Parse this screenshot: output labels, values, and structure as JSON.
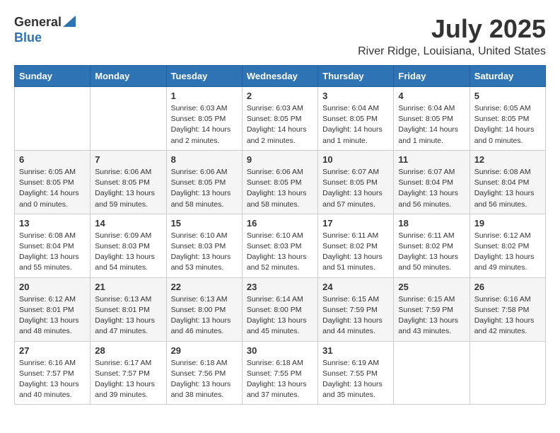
{
  "header": {
    "logo_general": "General",
    "logo_blue": "Blue",
    "title": "July 2025",
    "subtitle": "River Ridge, Louisiana, United States"
  },
  "calendar": {
    "days_of_week": [
      "Sunday",
      "Monday",
      "Tuesday",
      "Wednesday",
      "Thursday",
      "Friday",
      "Saturday"
    ],
    "weeks": [
      [
        {
          "num": "",
          "info": ""
        },
        {
          "num": "",
          "info": ""
        },
        {
          "num": "1",
          "info": "Sunrise: 6:03 AM\nSunset: 8:05 PM\nDaylight: 14 hours\nand 2 minutes."
        },
        {
          "num": "2",
          "info": "Sunrise: 6:03 AM\nSunset: 8:05 PM\nDaylight: 14 hours\nand 2 minutes."
        },
        {
          "num": "3",
          "info": "Sunrise: 6:04 AM\nSunset: 8:05 PM\nDaylight: 14 hours\nand 1 minute."
        },
        {
          "num": "4",
          "info": "Sunrise: 6:04 AM\nSunset: 8:05 PM\nDaylight: 14 hours\nand 1 minute."
        },
        {
          "num": "5",
          "info": "Sunrise: 6:05 AM\nSunset: 8:05 PM\nDaylight: 14 hours\nand 0 minutes."
        }
      ],
      [
        {
          "num": "6",
          "info": "Sunrise: 6:05 AM\nSunset: 8:05 PM\nDaylight: 14 hours\nand 0 minutes."
        },
        {
          "num": "7",
          "info": "Sunrise: 6:06 AM\nSunset: 8:05 PM\nDaylight: 13 hours\nand 59 minutes."
        },
        {
          "num": "8",
          "info": "Sunrise: 6:06 AM\nSunset: 8:05 PM\nDaylight: 13 hours\nand 58 minutes."
        },
        {
          "num": "9",
          "info": "Sunrise: 6:06 AM\nSunset: 8:05 PM\nDaylight: 13 hours\nand 58 minutes."
        },
        {
          "num": "10",
          "info": "Sunrise: 6:07 AM\nSunset: 8:05 PM\nDaylight: 13 hours\nand 57 minutes."
        },
        {
          "num": "11",
          "info": "Sunrise: 6:07 AM\nSunset: 8:04 PM\nDaylight: 13 hours\nand 56 minutes."
        },
        {
          "num": "12",
          "info": "Sunrise: 6:08 AM\nSunset: 8:04 PM\nDaylight: 13 hours\nand 56 minutes."
        }
      ],
      [
        {
          "num": "13",
          "info": "Sunrise: 6:08 AM\nSunset: 8:04 PM\nDaylight: 13 hours\nand 55 minutes."
        },
        {
          "num": "14",
          "info": "Sunrise: 6:09 AM\nSunset: 8:03 PM\nDaylight: 13 hours\nand 54 minutes."
        },
        {
          "num": "15",
          "info": "Sunrise: 6:10 AM\nSunset: 8:03 PM\nDaylight: 13 hours\nand 53 minutes."
        },
        {
          "num": "16",
          "info": "Sunrise: 6:10 AM\nSunset: 8:03 PM\nDaylight: 13 hours\nand 52 minutes."
        },
        {
          "num": "17",
          "info": "Sunrise: 6:11 AM\nSunset: 8:02 PM\nDaylight: 13 hours\nand 51 minutes."
        },
        {
          "num": "18",
          "info": "Sunrise: 6:11 AM\nSunset: 8:02 PM\nDaylight: 13 hours\nand 50 minutes."
        },
        {
          "num": "19",
          "info": "Sunrise: 6:12 AM\nSunset: 8:02 PM\nDaylight: 13 hours\nand 49 minutes."
        }
      ],
      [
        {
          "num": "20",
          "info": "Sunrise: 6:12 AM\nSunset: 8:01 PM\nDaylight: 13 hours\nand 48 minutes."
        },
        {
          "num": "21",
          "info": "Sunrise: 6:13 AM\nSunset: 8:01 PM\nDaylight: 13 hours\nand 47 minutes."
        },
        {
          "num": "22",
          "info": "Sunrise: 6:13 AM\nSunset: 8:00 PM\nDaylight: 13 hours\nand 46 minutes."
        },
        {
          "num": "23",
          "info": "Sunrise: 6:14 AM\nSunset: 8:00 PM\nDaylight: 13 hours\nand 45 minutes."
        },
        {
          "num": "24",
          "info": "Sunrise: 6:15 AM\nSunset: 7:59 PM\nDaylight: 13 hours\nand 44 minutes."
        },
        {
          "num": "25",
          "info": "Sunrise: 6:15 AM\nSunset: 7:59 PM\nDaylight: 13 hours\nand 43 minutes."
        },
        {
          "num": "26",
          "info": "Sunrise: 6:16 AM\nSunset: 7:58 PM\nDaylight: 13 hours\nand 42 minutes."
        }
      ],
      [
        {
          "num": "27",
          "info": "Sunrise: 6:16 AM\nSunset: 7:57 PM\nDaylight: 13 hours\nand 40 minutes."
        },
        {
          "num": "28",
          "info": "Sunrise: 6:17 AM\nSunset: 7:57 PM\nDaylight: 13 hours\nand 39 minutes."
        },
        {
          "num": "29",
          "info": "Sunrise: 6:18 AM\nSunset: 7:56 PM\nDaylight: 13 hours\nand 38 minutes."
        },
        {
          "num": "30",
          "info": "Sunrise: 6:18 AM\nSunset: 7:55 PM\nDaylight: 13 hours\nand 37 minutes."
        },
        {
          "num": "31",
          "info": "Sunrise: 6:19 AM\nSunset: 7:55 PM\nDaylight: 13 hours\nand 35 minutes."
        },
        {
          "num": "",
          "info": ""
        },
        {
          "num": "",
          "info": ""
        }
      ]
    ]
  }
}
